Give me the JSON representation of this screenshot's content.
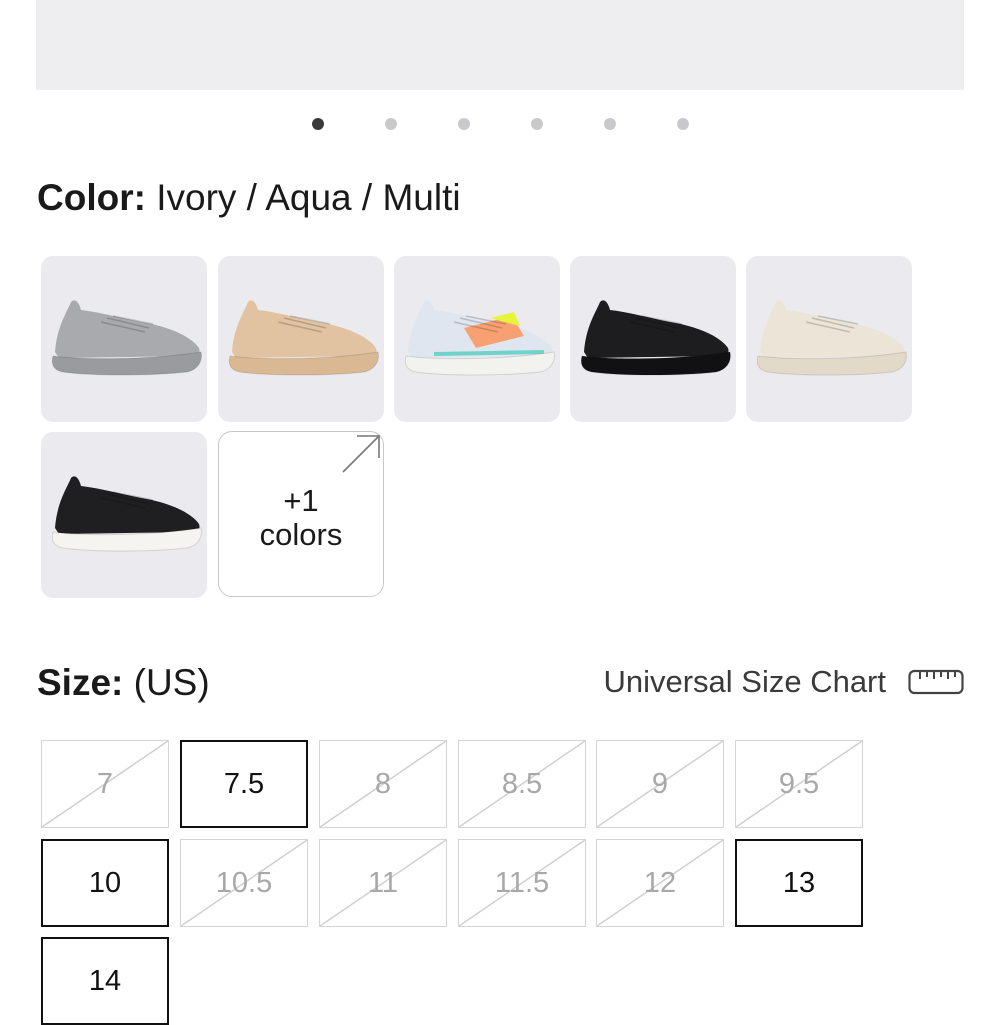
{
  "carousel": {
    "dot_count": 6,
    "active_index": 0
  },
  "color": {
    "label": "Color:",
    "selected_value": "Ivory / Aqua / Multi",
    "swatches": [
      {
        "name": "grey",
        "upper": "#a9aaad",
        "sole": "#9a9b9e"
      },
      {
        "name": "tan",
        "upper": "#e1c3a2",
        "sole": "#d9b893"
      },
      {
        "name": "ivory-aqua-multi",
        "upper": "#dfe6f0",
        "sole": "#f2f2ee"
      },
      {
        "name": "black",
        "upper": "#1d1d1f",
        "sole": "#111113"
      },
      {
        "name": "ivory",
        "upper": "#ece4d7",
        "sole": "#e3d9c9"
      },
      {
        "name": "black-white",
        "upper": "#1f1f21",
        "sole": "#f5f4f0"
      }
    ],
    "more_label_line1": "+1",
    "more_label_line2": "colors"
  },
  "size": {
    "label": "Size:",
    "unit": "(US)",
    "chart_link": "Universal Size Chart",
    "chart_icon": "ruler-icon",
    "options": [
      {
        "label": "7",
        "available": false
      },
      {
        "label": "7.5",
        "available": true
      },
      {
        "label": "8",
        "available": false
      },
      {
        "label": "8.5",
        "available": false
      },
      {
        "label": "9",
        "available": false
      },
      {
        "label": "9.5",
        "available": false
      },
      {
        "label": "10",
        "available": true
      },
      {
        "label": "10.5",
        "available": false
      },
      {
        "label": "11",
        "available": false
      },
      {
        "label": "11.5",
        "available": false
      },
      {
        "label": "12",
        "available": false
      },
      {
        "label": "13",
        "available": true
      },
      {
        "label": "14",
        "available": true
      }
    ]
  }
}
